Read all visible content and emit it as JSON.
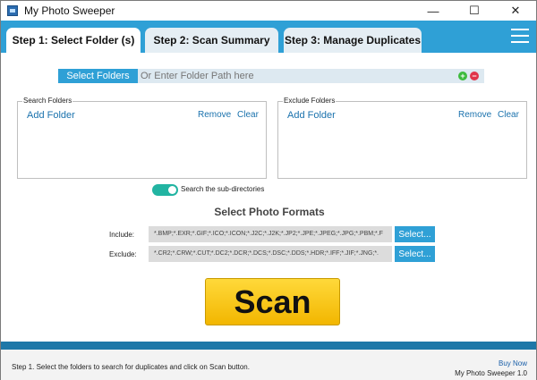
{
  "window": {
    "title": "My Photo Sweeper"
  },
  "tabs": [
    {
      "label": "Step 1: Select Folder (s)",
      "active": true
    },
    {
      "label": "Step 2: Scan Summary",
      "active": false
    },
    {
      "label": "Step 3: Manage Duplicates",
      "active": false
    }
  ],
  "path_row": {
    "button_label": "Select Folders",
    "placeholder": "Or Enter Folder Path here",
    "add_icon": "plus-icon",
    "remove_icon": "minus-icon"
  },
  "search_folders": {
    "title": "Search Folders",
    "add_label": "Add Folder",
    "remove_label": "Remove",
    "clear_label": "Clear"
  },
  "exclude_folders": {
    "title": "Exclude Folders",
    "add_label": "Add Folder",
    "remove_label": "Remove",
    "clear_label": "Clear"
  },
  "subdirectories": {
    "label": "Search the sub-directories",
    "enabled": true
  },
  "formats": {
    "title": "Select Photo Formats",
    "include_label": "Include:",
    "include_value": "*.BMP;*.EXR;*.GIF;*.ICO;*.ICON;*.J2C;*.J2K;*.JP2;*.JPE;*.JPEG;*.JPG;*.PBM;*.F",
    "exclude_label": "Exclude:",
    "exclude_value": "*.CR2;*.CRW;*.CUT;*.DC2;*.DCR;*.DCS;*.DSC;*.DDS;*.HDR;*.IFF;*.JIF;*.JNG;*.",
    "select_label": "Select..."
  },
  "scan": {
    "label": "Scan"
  },
  "status": {
    "text": "Step 1. Select the folders to search for duplicates and click on Scan button.",
    "buy_now": "Buy Now",
    "version": "My Photo Sweeper 1.0"
  },
  "colors": {
    "accent": "#2fa0d6",
    "scan": "#f9c80e",
    "toggle": "#22b4a2",
    "link": "#1a72ad"
  }
}
